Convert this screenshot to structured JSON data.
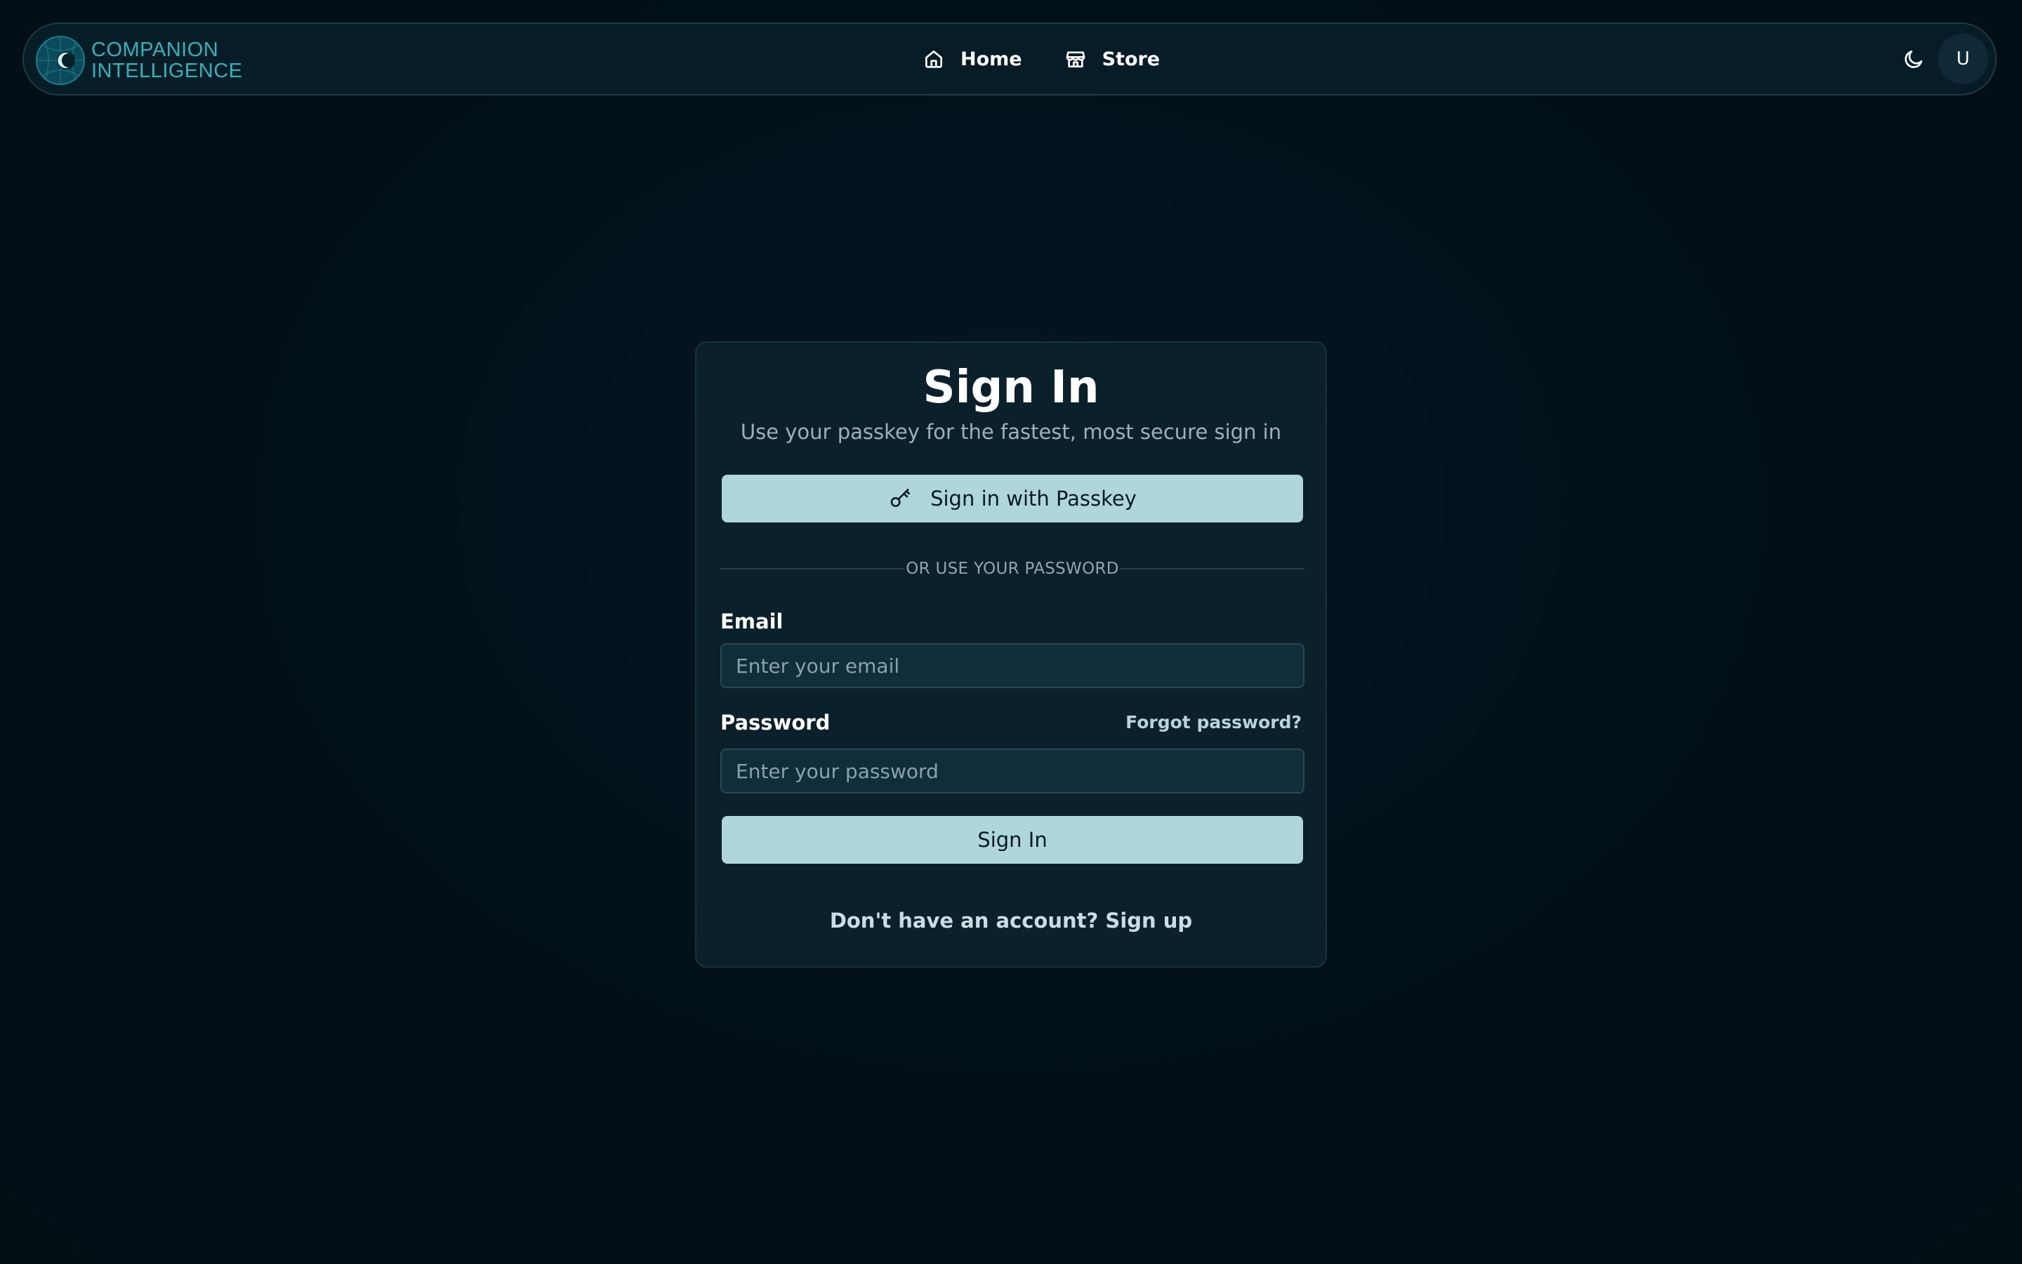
{
  "header": {
    "logo_line1": "COMPANION",
    "logo_line2": "INTELLIGENCE",
    "nav": [
      {
        "label": "Home",
        "icon": "home-icon"
      },
      {
        "label": "Store",
        "icon": "store-icon"
      }
    ],
    "theme_toggle_icon": "moon-icon",
    "avatar_initial": "U"
  },
  "signin": {
    "title": "Sign In",
    "subtitle": "Use your passkey for the fastest, most secure sign in",
    "passkey_button": "Sign in with Passkey",
    "passkey_icon": "key-icon",
    "divider": "OR USE YOUR PASSWORD",
    "email_label": "Email",
    "email_placeholder": "Enter your email",
    "email_value": "",
    "password_label": "Password",
    "forgot_password": "Forgot password?",
    "password_placeholder": "Enter your password",
    "password_value": "",
    "submit_button": "Sign In",
    "signup_prompt": "Don't have an account? Sign up"
  },
  "colors": {
    "background": "#020f18",
    "card": "#0a212c",
    "button": "#aed6db",
    "brand": "#35b3b8"
  }
}
